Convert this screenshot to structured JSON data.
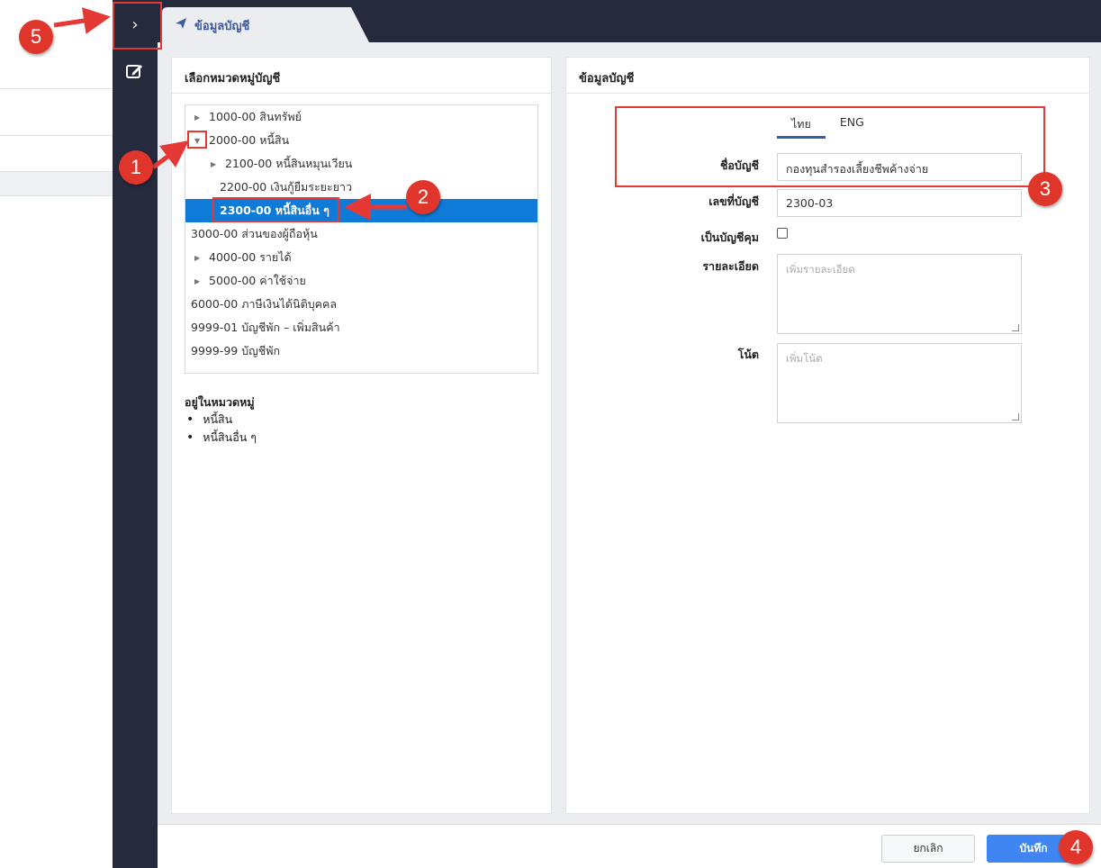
{
  "tab": {
    "label": "ข้อมูลบัญชี"
  },
  "left_panel": {
    "title": "เลือกหมวดหมู่บัญชี",
    "tree": [
      {
        "label": "1000-00 สินทรัพย์",
        "indent": 0,
        "caret": "right"
      },
      {
        "label": "2000-00 หนี้สิน",
        "indent": 0,
        "caret": "down"
      },
      {
        "label": "2100-00 หนี้สินหมุนเวียน",
        "indent": 1,
        "caret": "right"
      },
      {
        "label": "2200-00 เงินกู้ยืมระยะยาว",
        "indent": 1,
        "caret": "none"
      },
      {
        "label": "2300-00 หนี้สินอื่น ๆ",
        "indent": 1,
        "caret": "none",
        "selected": true
      },
      {
        "label": "3000-00 ส่วนของผู้ถือหุ้น",
        "indent": 0,
        "caret": "none"
      },
      {
        "label": "4000-00 รายได้",
        "indent": 0,
        "caret": "right"
      },
      {
        "label": "5000-00 ค่าใช้จ่าย",
        "indent": 0,
        "caret": "right"
      },
      {
        "label": "6000-00 ภาษีเงินได้นิติบุคคล",
        "indent": 0,
        "caret": "none"
      },
      {
        "label": "9999-01 บัญชีพัก – เพิ่มสินค้า",
        "indent": 0,
        "caret": "none"
      },
      {
        "label": "9999-99 บัญชีพัก",
        "indent": 0,
        "caret": "none"
      }
    ],
    "category_title": "อยู่ในหมวดหมู่",
    "categories": [
      "หนี้สิน",
      "หนี้สินอื่น ๆ"
    ]
  },
  "right_panel": {
    "title": "ข้อมูลบัญชี",
    "lang_tabs": [
      "ไทย",
      "ENG"
    ],
    "active_lang": "ไทย",
    "account_name_label": "ชื่อบัญชี",
    "account_name_value": "กองทุนสำรองเลี้ยงชีพค้างจ่าย",
    "account_no_label": "เลขที่บัญชี",
    "account_no_value": "2300-03",
    "control_label": "เป็นบัญชีคุม",
    "control_checked": false,
    "detail_label": "รายละเอียด",
    "detail_placeholder": "เพิ่มรายละเอียด",
    "note_label": "โน้ต",
    "note_placeholder": "เพิ่มโน้ต"
  },
  "footer": {
    "cancel_label": "ยกเลิก",
    "save_label": "บันทึก"
  },
  "annotations": [
    "1",
    "2",
    "3",
    "4",
    "5"
  ],
  "colors": {
    "sidebar": "#252a3d",
    "selected": "#0f7ad8",
    "save": "#3f86f2",
    "marker": "#e0352b"
  }
}
